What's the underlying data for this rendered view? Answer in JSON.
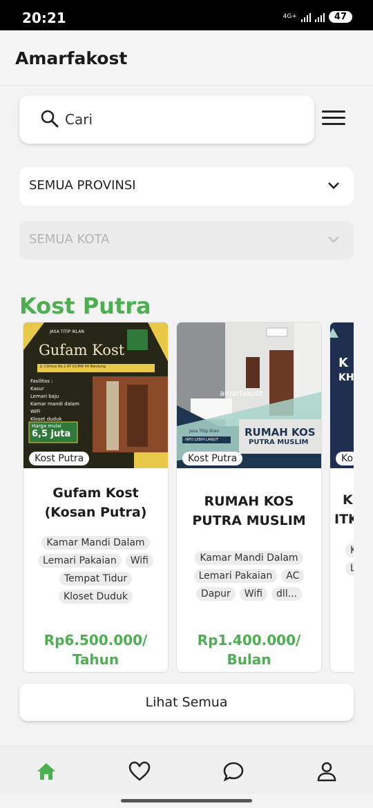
{
  "status_bar": {
    "time": "20:21",
    "network": "4G+",
    "battery": "47"
  },
  "app": {
    "title": "Amarfakost"
  },
  "search": {
    "placeholder": "Cari"
  },
  "filters": {
    "province": "SEMUA PROVINSI",
    "city": "SEMUA KOTA"
  },
  "section": {
    "title": "Kost Putra"
  },
  "cards": [
    {
      "badge": "Kost Putra",
      "name": "Gufam Kost (Kosan Putra)",
      "tags": [
        "Kamar Mandi Dalam",
        "Lemari Pakaian",
        "Wifi",
        "Tempat Tidur",
        "Kloset Duduk"
      ],
      "price": "Rp6.500.000/ Tahun",
      "image": {
        "heading": "Gufam Kost",
        "brand": "JASA TITIP IKLAN",
        "address": "Jl. Cilimus No.1 RT 01/RW 04 Bandung",
        "facilities_title": "Fasilitas :",
        "facilities": [
          "Kasur",
          "Lemari baju",
          "Kamar mandi dalam",
          "WiFi",
          "Kloset duduk"
        ],
        "price_label": "Harga mulai",
        "price_value": "6,5 juta"
      }
    },
    {
      "badge": "Kost Putra",
      "name": "RUMAH KOS PUTRA MUSLIM",
      "tags": [
        "Kamar Mandi Dalam",
        "Lemari Pakaian",
        "AC",
        "Dapur",
        "Wifi",
        "dll..."
      ],
      "price": "Rp1.400.000/ Bulan",
      "image": {
        "heading": "RUMAH KOS",
        "subheading": "PUTRA MUSLIM",
        "brand": "Jasa Titip Iklan",
        "watermark": "amarfakost",
        "info": "INFO LEBIH LANJUT"
      }
    },
    {
      "badge": "Ko",
      "name": "K",
      "name2": "ITK",
      "tags": [
        "K",
        "L"
      ],
      "price": "",
      "image": {
        "heading": "K",
        "subheading": "KH"
      }
    }
  ],
  "see_all": "Lihat Semua",
  "nav": {
    "items": [
      "home-icon",
      "heart-icon",
      "chat-icon",
      "profile-icon"
    ],
    "active_color": "#4caf50"
  },
  "colors": {
    "accent": "#4caf50"
  }
}
